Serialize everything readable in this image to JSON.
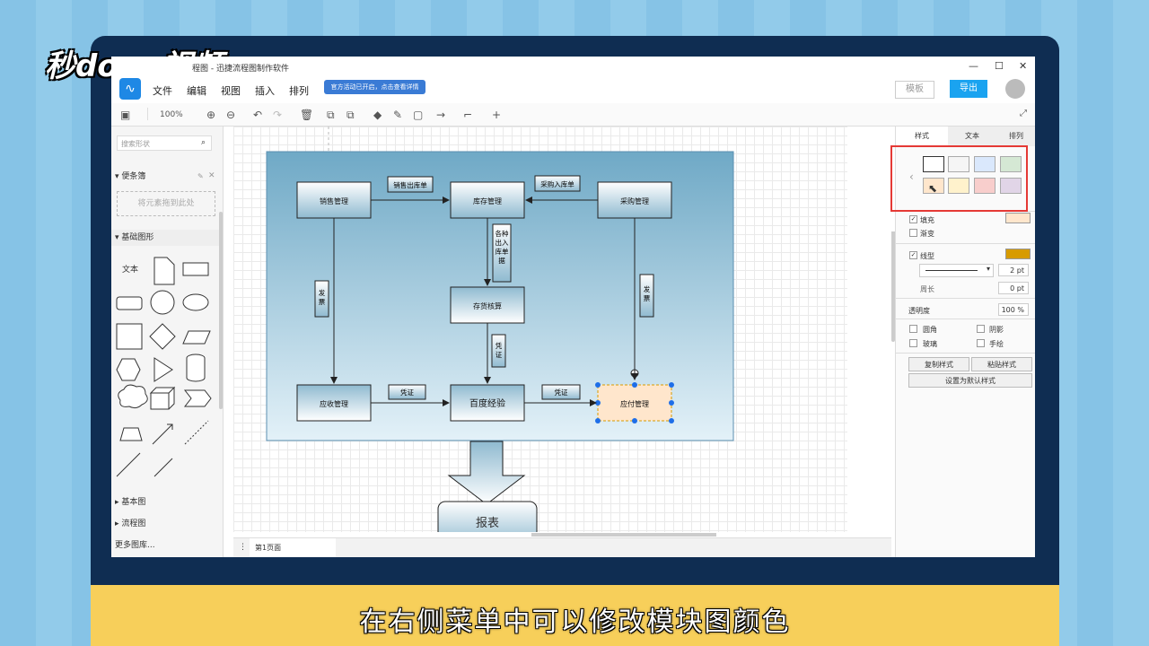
{
  "watermark": {
    "logo_text": "秒dong视频"
  },
  "caption": "在右侧菜单中可以修改模块图颜色",
  "window": {
    "title": "程图 - 迅捷流程图制作软件",
    "controls": [
      "—",
      "☐",
      "✕"
    ]
  },
  "menubar": {
    "app_icon": "flow-app-icon",
    "items": [
      "文件",
      "编辑",
      "视图",
      "插入",
      "排列"
    ],
    "notice": "官方活动已开启，点击查看详情",
    "template_label": "模板",
    "export_label": "导出"
  },
  "toolbar": {
    "zoom": "100%"
  },
  "left_panel": {
    "search_placeholder": "搜索形状",
    "scratchpad_title": "便条簿",
    "dropzone_text": "将元素拖到此处",
    "basic_shapes_title": "基础图形",
    "text_shape_label": "文本",
    "sections": [
      "基本图",
      "流程图"
    ],
    "more_libraries": "更多图库..."
  },
  "diagram": {
    "nodes": {
      "sales": "销售管理",
      "inventory": "库存管理",
      "purchase": "采购管理",
      "stock_calc": "存货核算",
      "receivable": "应收管理",
      "baidu": "百度经验",
      "payable": "应付管理",
      "report": "报表"
    },
    "labels": {
      "sales_out": "销售出库单",
      "purchase_in": "采购入库单",
      "various_docs": "各种出入库单据",
      "invoice_left": "发票",
      "invoice_right": "发票",
      "voucher_mid": "凭证",
      "voucher_left": "凭证",
      "voucher_right": "凭证"
    }
  },
  "page_bar": {
    "page_tab": "第1页面"
  },
  "right_panel": {
    "tabs": [
      "样式",
      "文本",
      "排列"
    ],
    "swatches": [
      "#ffffff",
      "#f5f5f5",
      "#dae8fc",
      "#d5e8d4",
      "#ffe6cc",
      "#fff2cc",
      "#f8cecc",
      "#e1d5e7"
    ],
    "fill_label": "填充",
    "fill_color": "#ffe6cc",
    "gradient_label": "渐变",
    "line_label": "线型",
    "line_color": "#d79b00",
    "line_width": "2 pt",
    "perimeter_label": "周长",
    "perimeter_value": "0 pt",
    "opacity_label": "透明度",
    "opacity_value": "100 %",
    "rounded_label": "圆角",
    "shadow_label": "阴影",
    "glass_label": "玻璃",
    "sketch_label": "手绘",
    "copy_style": "复制样式",
    "paste_style": "粘贴样式",
    "set_default": "设置为默认样式"
  }
}
